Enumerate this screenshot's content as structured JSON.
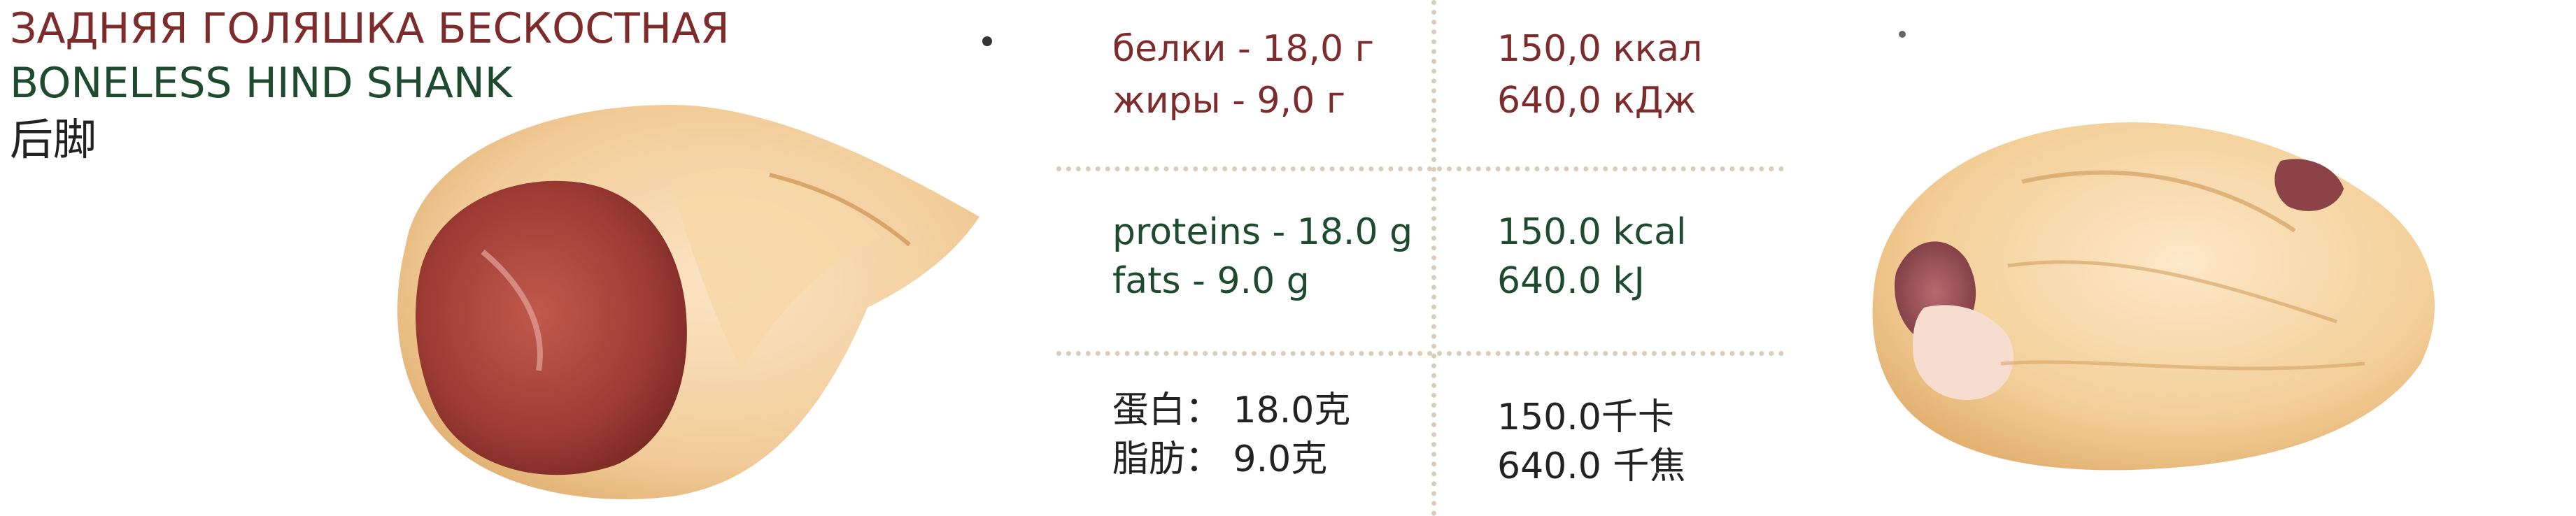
{
  "product": {
    "title_ru": "ЗАДНЯЯ ГОЛЯШКА БЕСКОСТНАЯ",
    "title_en": "BONELESS HIND SHANK",
    "title_zh": "后脚"
  },
  "nutrition": {
    "ru": {
      "proteins": "белки - 18,0 г",
      "fats": "жиры - 9,0 г",
      "kcal": "150,0 ккал",
      "kj": "640,0 кДж"
    },
    "en": {
      "proteins": "proteins - 18.0 g",
      "fats": "fats - 9.0 g",
      "kcal": "150.0 kcal",
      "kj": "640.0 kJ"
    },
    "zh": {
      "proteins": "蛋白： 18.0克",
      "fats": "脂肪： 9.0克",
      "kcal": "150.0千卡",
      "kj": "640.0 千焦"
    }
  }
}
